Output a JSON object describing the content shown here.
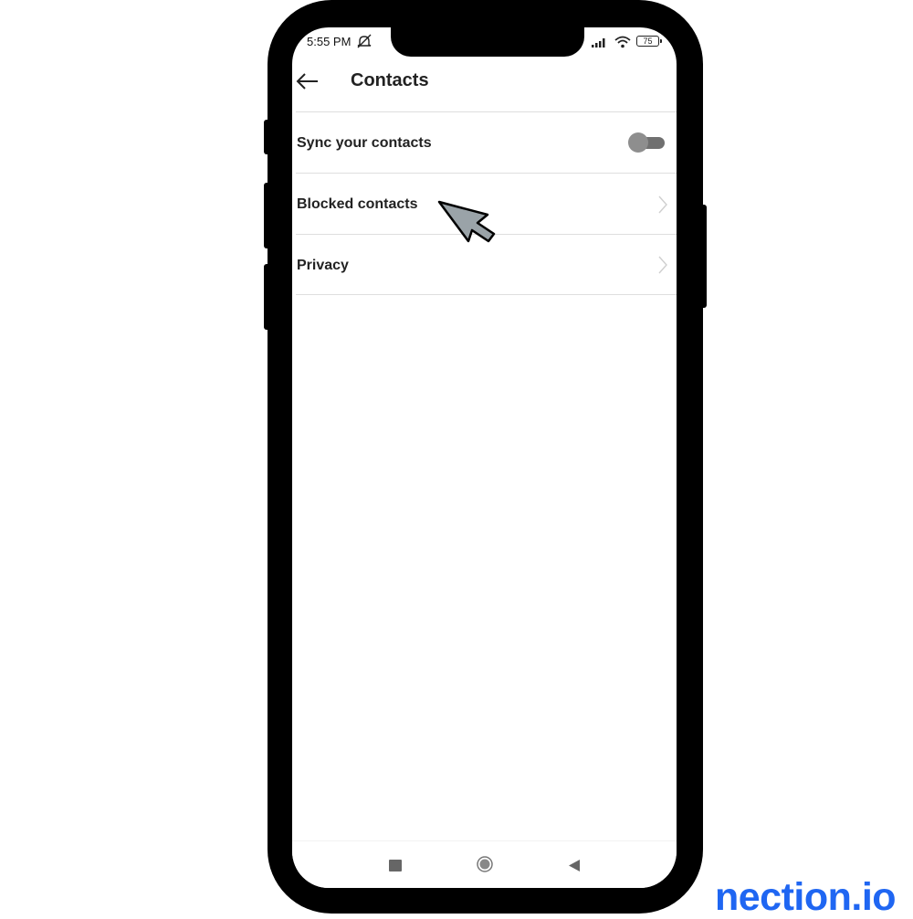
{
  "status_bar": {
    "time": "5:55 PM",
    "battery": "75"
  },
  "header": {
    "title": "Contacts"
  },
  "settings": {
    "sync_contacts": {
      "label": "Sync your contacts",
      "enabled": false
    },
    "blocked_contacts": {
      "label": "Blocked contacts"
    },
    "privacy": {
      "label": "Privacy"
    }
  },
  "nav_bar": {
    "icons": [
      "recents-square-icon",
      "home-circle-icon",
      "back-triangle-icon"
    ]
  },
  "watermark": {
    "text": "nection.io",
    "color": "#1f66f2"
  },
  "colors": {
    "toggle_off": "#8e8e8e",
    "text": "#222222",
    "divider": "#dedede"
  }
}
